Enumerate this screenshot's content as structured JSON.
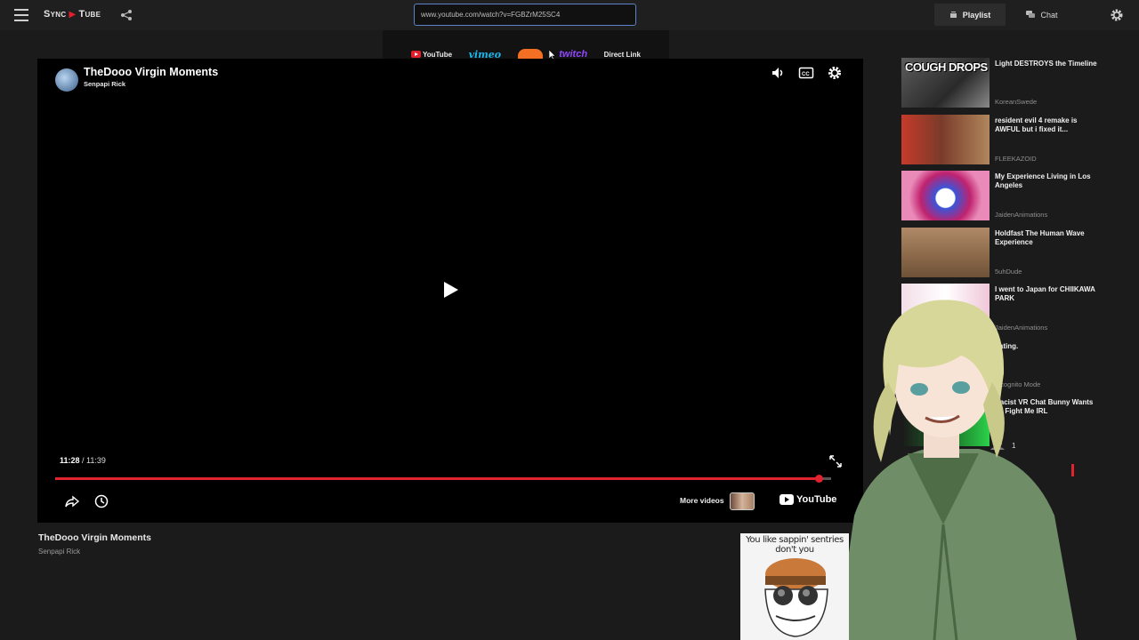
{
  "topbar": {
    "menu_icon": "hamburger-icon",
    "brand_left": "Sync",
    "brand_play": "▶",
    "brand_right": "Tube",
    "share_icon": "share-icon",
    "url_value": "www.youtube.com/watch?v=FGBZrM25SC4",
    "tabs": [
      {
        "label": "Playlist",
        "icon": "playlist-icon"
      },
      {
        "label": "Chat",
        "icon": "chat-icon"
      }
    ],
    "settings_icon": "gear-icon"
  },
  "providers": {
    "youtube": "YouTube",
    "vimeo": "vimeo",
    "twitch": "twitch",
    "direct": "Direct Link"
  },
  "player": {
    "title": "TheDooo Virgin Moments",
    "channel": "Senpapi Rick",
    "current_time": "11:28",
    "separator": " / ",
    "duration": "11:39",
    "progress": 0.9842,
    "more_videos": "More videos",
    "youtube_logo": "YouTube",
    "accent_color": "#e0232f"
  },
  "below": {
    "title": "TheDooo Virgin Moments",
    "channel": "Senpapi Rick"
  },
  "related": [
    {
      "title": "Light DESTROYS the Timeline",
      "channel": "KoreanSwede",
      "thumb_text": "COUGH DROPS"
    },
    {
      "title": "resident evil 4 remake is AWFUL but i fixed it...",
      "channel": "FLEEKAZOID"
    },
    {
      "title": "My Experience Living in Los Angeles",
      "channel": "JaidenAnimations"
    },
    {
      "title": "Holdfast The Human Wave Experience",
      "channel": "5uhDude"
    },
    {
      "title": "I went to Japan for CHIIKAWA PARK",
      "channel": "JaidenAnimations"
    },
    {
      "title": "dating.",
      "channel": "Incognito Mode"
    },
    {
      "title": "Racist VR Chat Bunny Wants To Fight Me IRL",
      "channel": ""
    }
  ],
  "viewers": {
    "count": "1"
  },
  "sticker": {
    "text": "You like sappin' sentries don't you"
  }
}
